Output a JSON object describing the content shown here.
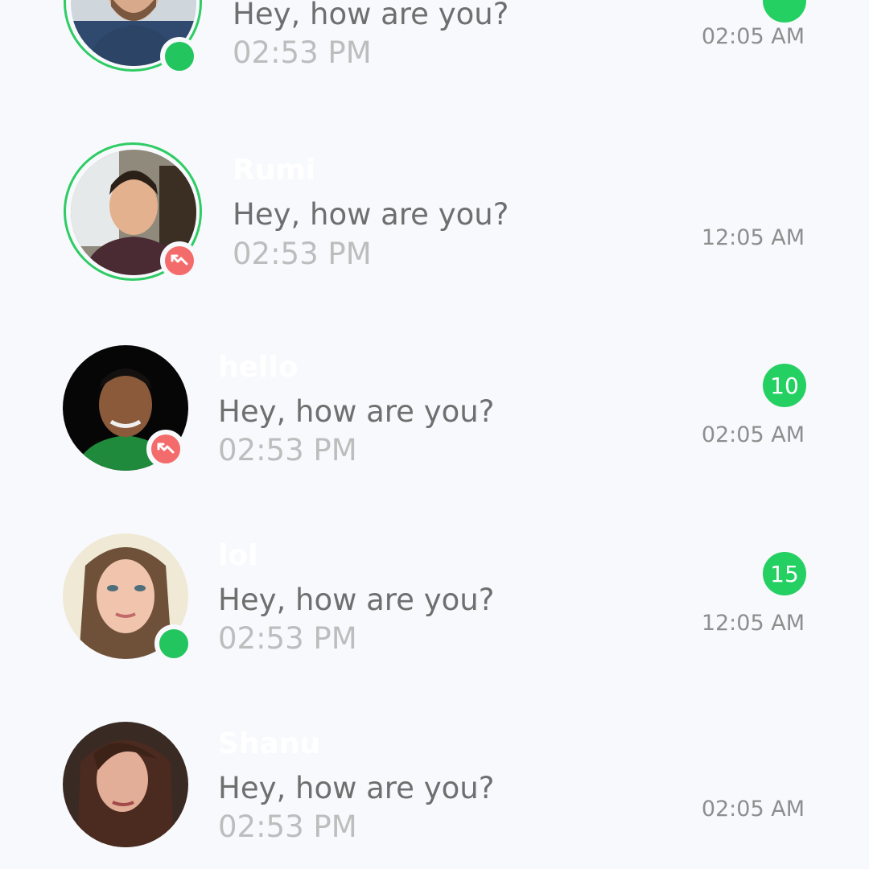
{
  "colors": {
    "background": "#f8f9fc",
    "online": "#22c55e",
    "missed": "#f46b6b",
    "badge": "#25d063",
    "ring": "#2ecc64"
  },
  "chats": [
    {
      "name": "",
      "message": "Hey, how are you?",
      "sub_time": "02:53 PM",
      "time": "02:05 AM",
      "unread": "",
      "status": "online",
      "status_icon": "online-dot-icon"
    },
    {
      "name": "Rumi",
      "message": "Hey, how are you?",
      "sub_time": "02:53 PM",
      "time": "12:05 AM",
      "unread": "",
      "status": "missed",
      "status_icon": "missed-call-icon"
    },
    {
      "name": "hello",
      "message": "Hey, how are you?",
      "sub_time": "02:53 PM",
      "time": "02:05 AM",
      "unread": "10",
      "status": "missed",
      "status_icon": "missed-call-icon"
    },
    {
      "name": "lol",
      "message": "Hey, how are you?",
      "sub_time": "02:53 PM",
      "time": "12:05 AM",
      "unread": "15",
      "status": "online",
      "status_icon": "online-dot-icon"
    },
    {
      "name": "Shanu",
      "message": "Hey, how are you?",
      "sub_time": "02:53 PM",
      "time": "02:05 AM",
      "unread": "",
      "status": "none",
      "status_icon": ""
    }
  ]
}
